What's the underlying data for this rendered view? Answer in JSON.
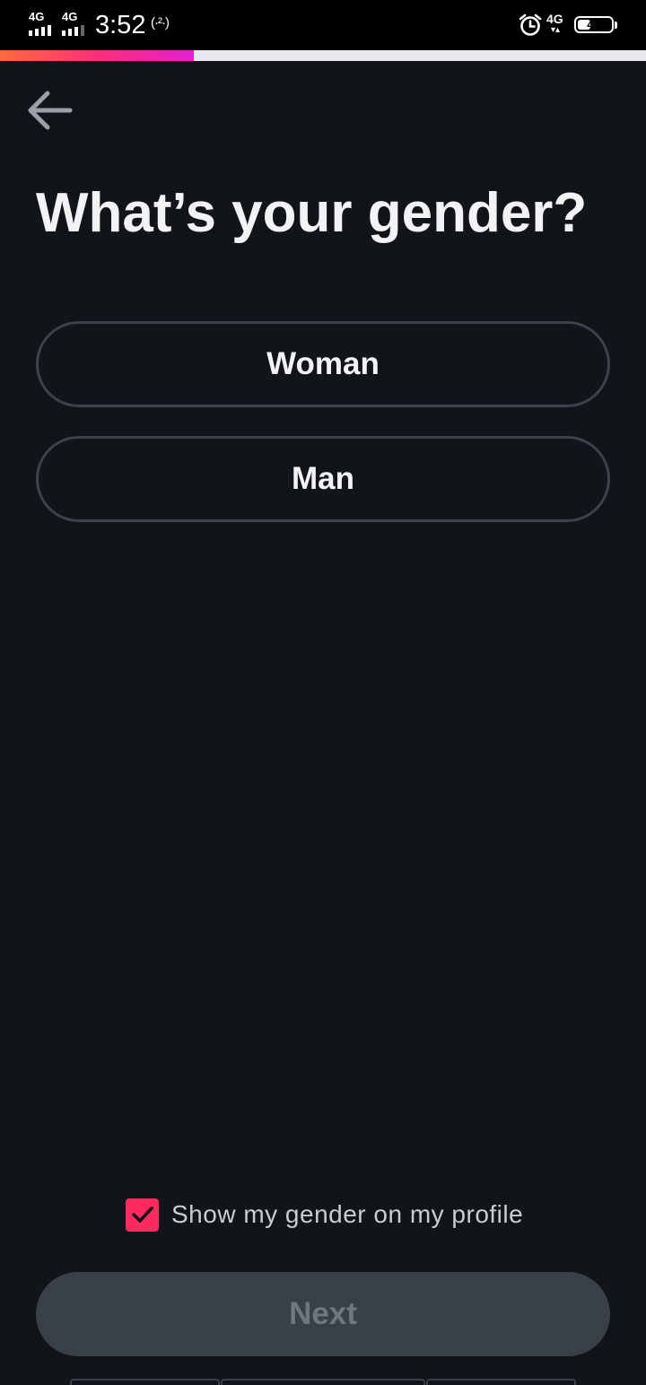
{
  "status_bar": {
    "network_left_1": "4G",
    "network_left_2": "4G",
    "time": "3:52",
    "hotspot_label": "(·²·)",
    "network_right": "4G",
    "network_right_arrows": "▾▴",
    "battery_level": "45",
    "battery_fraction": 0.45
  },
  "progress": {
    "fraction": 0.3,
    "gradient_colors": [
      "#ff6b3d",
      "#fd2e78",
      "#e51fd0"
    ]
  },
  "header": {
    "back_icon": "arrow-left-icon"
  },
  "main": {
    "title": "What’s your gender?",
    "options": [
      {
        "label": "Woman"
      },
      {
        "label": "Man"
      }
    ]
  },
  "footer": {
    "show_gender_label": "Show my gender on my profile",
    "show_gender_checked": true,
    "next_label": "Next"
  },
  "colors": {
    "background": "#111418",
    "accent": "#ff2a60",
    "option_border": "#3c424c",
    "next_disabled_bg": "#3a404a",
    "next_disabled_text": "#6f7680"
  }
}
